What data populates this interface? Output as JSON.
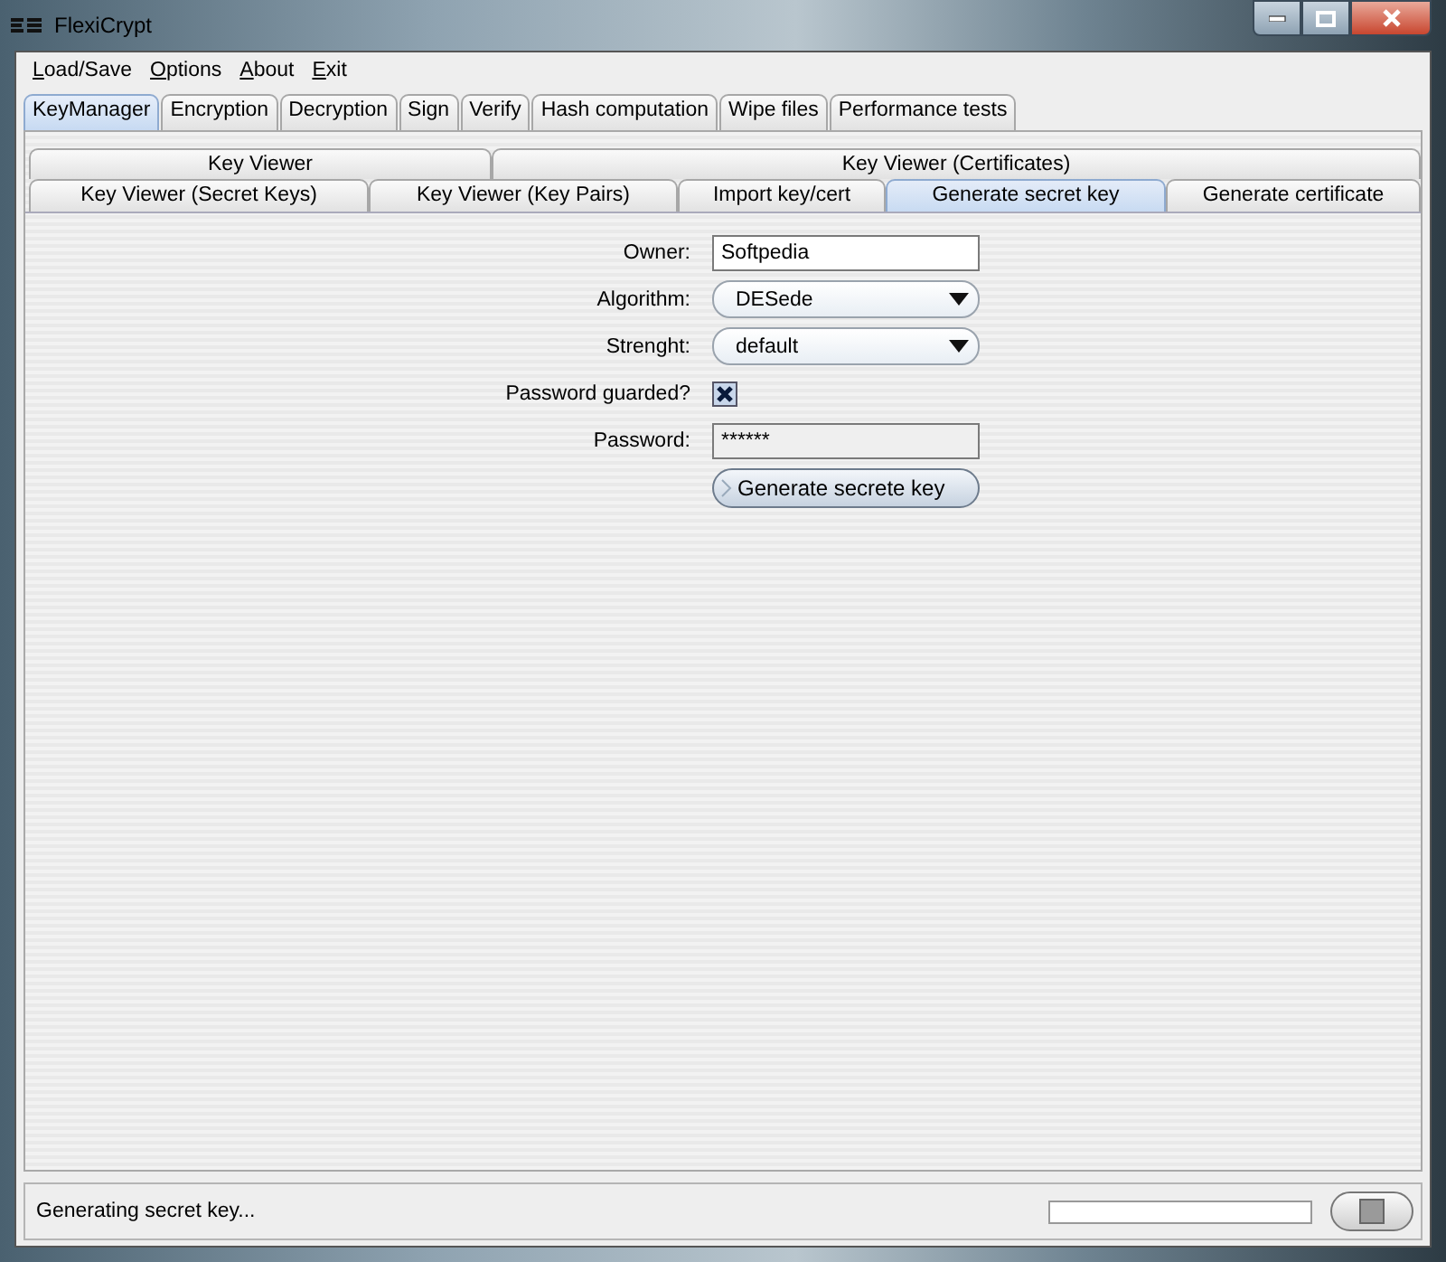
{
  "window": {
    "title": "FlexiCrypt"
  },
  "menu": [
    "Load/Save",
    "Options",
    "About",
    "Exit"
  ],
  "tabs": [
    {
      "label": "KeyManager",
      "selected": true
    },
    {
      "label": "Encryption",
      "selected": false
    },
    {
      "label": "Decryption",
      "selected": false
    },
    {
      "label": "Sign",
      "selected": false
    },
    {
      "label": "Verify",
      "selected": false
    },
    {
      "label": "Hash computation",
      "selected": false
    },
    {
      "label": "Wipe files",
      "selected": false
    },
    {
      "label": "Performance tests",
      "selected": false
    }
  ],
  "subtabs": [
    [
      {
        "label": "Key Viewer",
        "selected": false
      },
      {
        "label": "Key Viewer (Certificates)",
        "selected": false
      }
    ],
    [
      {
        "label": "Key Viewer (Secret Keys)",
        "selected": false
      },
      {
        "label": "Key Viewer (Key Pairs)",
        "selected": false
      },
      {
        "label": "Import key/cert",
        "selected": false
      },
      {
        "label": "Generate secret key",
        "selected": true
      },
      {
        "label": "Generate certificate",
        "selected": false
      }
    ]
  ],
  "form": [
    {
      "kind": "text",
      "label": "Owner:",
      "value": "Softpedia"
    },
    {
      "kind": "select",
      "label": "Algorithm:",
      "value": "DESede"
    },
    {
      "kind": "select",
      "label": "Strenght:",
      "value": "default"
    },
    {
      "kind": "checkbox",
      "label": "Password guarded?",
      "checked": true
    },
    {
      "kind": "password",
      "label": "Password:",
      "value": "******"
    }
  ],
  "action": "Generate secrete key",
  "status_bar": {
    "text": "Generating secret key...",
    "level": 0
  }
}
